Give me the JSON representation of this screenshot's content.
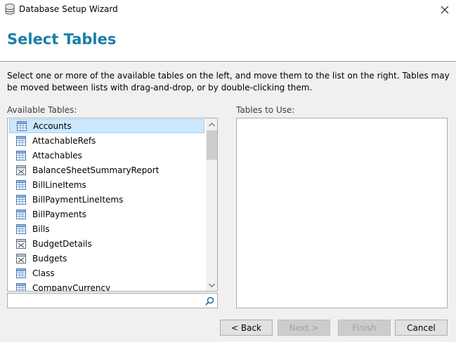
{
  "window": {
    "title": "Database Setup Wizard",
    "app_icon": "database-icon",
    "close_icon": "close-icon"
  },
  "header": {
    "title": "Select Tables"
  },
  "description": "Select one or more of the available tables on the left, and move them to the list on the right. Tables may be moved between lists with drag-and-drop, or by double-clicking them.",
  "available": {
    "label": "Available Tables:",
    "items": [
      {
        "label": "Accounts",
        "icon": "table-icon",
        "selected": true
      },
      {
        "label": "AttachableRefs",
        "icon": "table-icon"
      },
      {
        "label": "Attachables",
        "icon": "table-icon"
      },
      {
        "label": "BalanceSheetSummaryReport",
        "icon": "report-icon"
      },
      {
        "label": "BillLineItems",
        "icon": "table-icon"
      },
      {
        "label": "BillPaymentLineItems",
        "icon": "table-icon"
      },
      {
        "label": "BillPayments",
        "icon": "table-icon"
      },
      {
        "label": "Bills",
        "icon": "table-icon"
      },
      {
        "label": "BudgetDetails",
        "icon": "report-icon"
      },
      {
        "label": "Budgets",
        "icon": "report-icon"
      },
      {
        "label": "Class",
        "icon": "table-icon"
      },
      {
        "label": "CompanyCurrency",
        "icon": "table-icon"
      }
    ],
    "search_value": "",
    "search_icon": "search-icon"
  },
  "tables_to_use": {
    "label": "Tables to Use:",
    "items": []
  },
  "buttons": {
    "back": "< Back",
    "next": "Next >",
    "finish": "Finish",
    "cancel": "Cancel"
  },
  "colors": {
    "title_accent": "#1a7fa8",
    "selection": "#cce8ff"
  }
}
